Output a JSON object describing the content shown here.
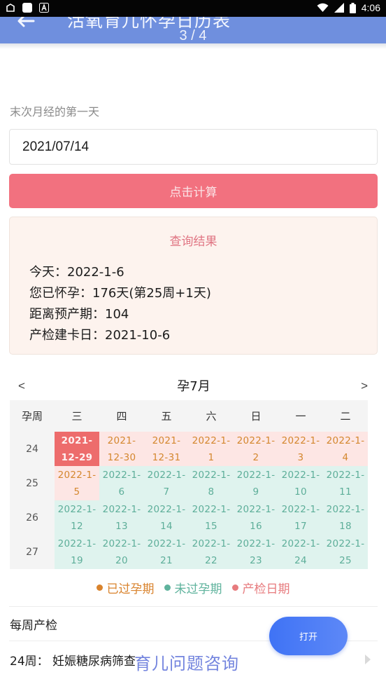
{
  "status_bar": {
    "time": "4:06",
    "icons": [
      "notification-icon",
      "app-square-icon",
      "app-a-icon",
      "wifi-icon",
      "signal-icon",
      "battery-icon"
    ]
  },
  "header": {
    "title": "活氧育儿怀孕日历表",
    "pager": "3 / 4"
  },
  "form": {
    "label": "末次月经的第一天",
    "date_value": "2021/07/14",
    "calc_button": "点击计算"
  },
  "result": {
    "title": "查询结果",
    "lines": [
      "今天：2022-1-6",
      "您已怀孕：176天(第25周+1天)",
      "距离预产期：104",
      "产检建卡日：2021-10-6"
    ]
  },
  "calendar": {
    "prev": "<",
    "next": ">",
    "month": "孕7月",
    "headers": [
      "孕周",
      "三",
      "四",
      "五",
      "六",
      "日",
      "一",
      "二"
    ],
    "weeks": [
      {
        "week": "24",
        "days": [
          {
            "line1": "2021-",
            "line2": "12-29",
            "state": "today"
          },
          {
            "line1": "2021-",
            "line2": "12-30",
            "state": "past"
          },
          {
            "line1": "2021-",
            "line2": "12-31",
            "state": "past"
          },
          {
            "line1": "2022-1-",
            "line2": "1",
            "state": "past"
          },
          {
            "line1": "2022-1-",
            "line2": "2",
            "state": "past"
          },
          {
            "line1": "2022-1-",
            "line2": "3",
            "state": "past"
          },
          {
            "line1": "2022-1-",
            "line2": "4",
            "state": "past"
          }
        ]
      },
      {
        "week": "25",
        "days": [
          {
            "line1": "2022-1-",
            "line2": "5",
            "state": "past"
          },
          {
            "line1": "2022-1-",
            "line2": "6",
            "state": "future"
          },
          {
            "line1": "2022-1-",
            "line2": "7",
            "state": "future"
          },
          {
            "line1": "2022-1-",
            "line2": "8",
            "state": "future"
          },
          {
            "line1": "2022-1-",
            "line2": "9",
            "state": "future"
          },
          {
            "line1": "2022-1-",
            "line2": "10",
            "state": "future"
          },
          {
            "line1": "2022-1-",
            "line2": "11",
            "state": "future"
          }
        ]
      },
      {
        "week": "26",
        "days": [
          {
            "line1": "2022-1-",
            "line2": "12",
            "state": "future"
          },
          {
            "line1": "2022-1-",
            "line2": "13",
            "state": "future"
          },
          {
            "line1": "2022-1-",
            "line2": "14",
            "state": "future"
          },
          {
            "line1": "2022-1-",
            "line2": "15",
            "state": "future"
          },
          {
            "line1": "2022-1-",
            "line2": "16",
            "state": "future"
          },
          {
            "line1": "2022-1-",
            "line2": "17",
            "state": "future"
          },
          {
            "line1": "2022-1-",
            "line2": "18",
            "state": "future"
          }
        ]
      },
      {
        "week": "27",
        "days": [
          {
            "line1": "2022-1-",
            "line2": "19",
            "state": "future"
          },
          {
            "line1": "2022-1-",
            "line2": "20",
            "state": "future"
          },
          {
            "line1": "2022-1-",
            "line2": "21",
            "state": "future"
          },
          {
            "line1": "2022-1-",
            "line2": "22",
            "state": "future"
          },
          {
            "line1": "2022-1-",
            "line2": "23",
            "state": "future"
          },
          {
            "line1": "2022-1-",
            "line2": "24",
            "state": "future"
          },
          {
            "line1": "2022-1-",
            "line2": "25",
            "state": "future"
          }
        ]
      }
    ]
  },
  "legend": [
    {
      "label": "已过孕期",
      "color": "#d9832d"
    },
    {
      "label": "未过孕期",
      "color": "#5fb39d"
    },
    {
      "label": "产检日期",
      "color": "#e77b7e"
    }
  ],
  "weekly_checkup": {
    "title": "每周产检",
    "item": "24周：  妊娠糖尿病筛查"
  },
  "promo": {
    "text": "育儿问题咨询"
  },
  "open_button": {
    "label": "打开"
  },
  "colors": {
    "header_bg": "#6f8fde",
    "calc_button": "#f2717f",
    "result_title": "#e07583",
    "today_cell": "#ed6c6c",
    "past_cell": "#fde6e4",
    "future_cell": "#dff3ee",
    "open_button": "#4a7bf6"
  }
}
